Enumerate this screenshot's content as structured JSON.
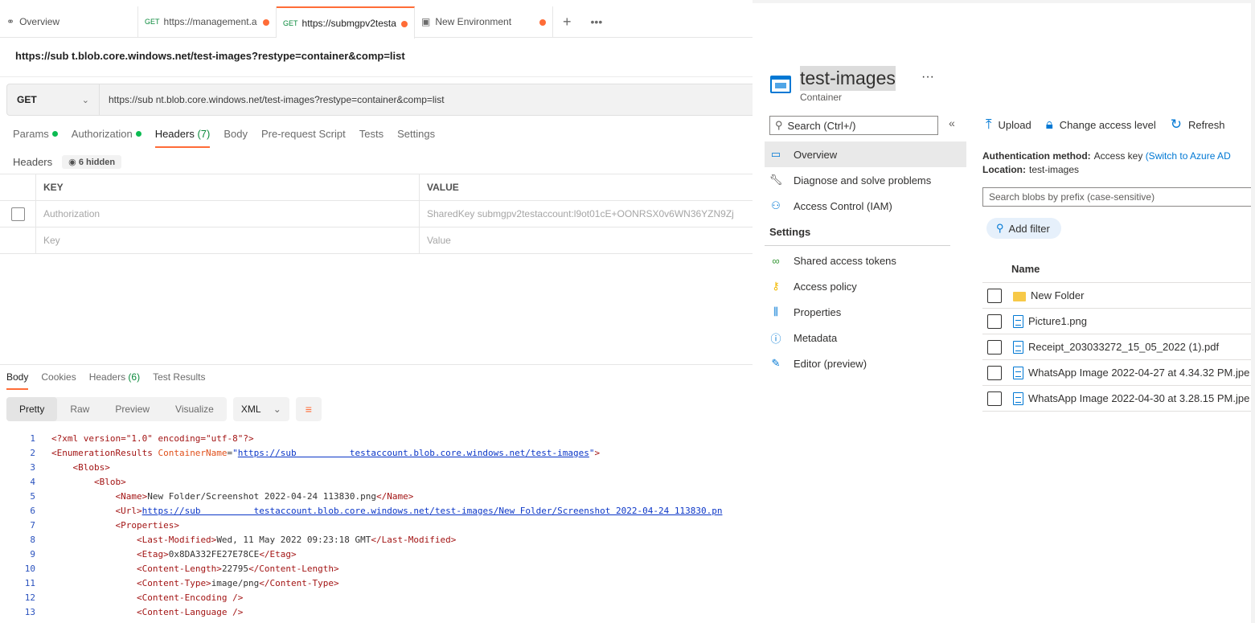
{
  "postman": {
    "tabs": [
      {
        "label": "Overview",
        "method": ""
      },
      {
        "label": "https://management.a",
        "method": "GET"
      },
      {
        "label": "https://submgpv2testa",
        "method": "GET"
      },
      {
        "label": "New Environment",
        "method": ""
      }
    ],
    "title": "https://sub      t.blob.core.windows.net/test-images?restype=container&comp=list",
    "method": "GET",
    "url": "https://sub              nt.blob.core.windows.net/test-images?restype=container&comp=list",
    "request_tabs": {
      "params": "Params",
      "authorization": "Authorization",
      "headers": "Headers",
      "headers_count": "(7)",
      "body": "Body",
      "prerequest": "Pre-request Script",
      "tests": "Tests",
      "settings": "Settings"
    },
    "headers_label": "Headers",
    "hidden_label": "6 hidden",
    "table": {
      "key_header": "KEY",
      "value_header": "VALUE",
      "rows": [
        {
          "key": "Authorization",
          "value": "SharedKey submgpv2testaccount:l9ot01cE+OONRSX0v6WN36YZN9Zj"
        },
        {
          "key": "Key",
          "value": "Value"
        }
      ]
    },
    "response_tabs": {
      "body": "Body",
      "cookies": "Cookies",
      "headers": "Headers",
      "headers_count": "(6)",
      "test_results": "Test Results"
    },
    "view_modes": [
      "Pretty",
      "Raw",
      "Preview",
      "Visualize"
    ],
    "format": "XML",
    "code": {
      "l1_decl": "<?xml version=\"1.0\" encoding=\"utf-8\"?>",
      "l2_url": "https://sub          testaccount.blob.core.windows.net/test-images",
      "l5_name": "New Folder/Screenshot 2022-04-24 113830.png",
      "l6_url": "https://sub          testaccount.blob.core.windows.net/test-images/New Folder/Screenshot 2022-04-24 113830.pn",
      "l8_modified": "Wed, 11 May 2022 09:23:18 GMT",
      "l9_etag": "0x8DA332FE27E78CE",
      "l10_length": "22795",
      "l11_type": "image/png"
    }
  },
  "azure": {
    "title": "test-images",
    "subtitle": "Container",
    "more": "···",
    "search_placeholder": "Search (Ctrl+/)",
    "collapse": "«",
    "nav": {
      "overview": "Overview",
      "diagnose": "Diagnose and solve problems",
      "iam": "Access Control (IAM)",
      "settings_header": "Settings",
      "sas": "Shared access tokens",
      "policy": "Access policy",
      "properties": "Properties",
      "metadata": "Metadata",
      "editor": "Editor (preview)"
    },
    "toolbar": {
      "upload": "Upload",
      "change_access": "Change access level",
      "refresh": "Refresh"
    },
    "auth_method_label": "Authentication method:",
    "auth_method_value": "Access key",
    "auth_switch": "(Switch to Azure AD",
    "location_label": "Location:",
    "location_value": "test-images",
    "blob_search_placeholder": "Search blobs by prefix (case-sensitive)",
    "add_filter": "Add filter",
    "name_header": "Name",
    "blobs": [
      {
        "name": "New Folder",
        "kind": "folder"
      },
      {
        "name": "Picture1.png",
        "kind": "file"
      },
      {
        "name": "Receipt_203033272_15_05_2022 (1).pdf",
        "kind": "file"
      },
      {
        "name": "WhatsApp Image 2022-04-27 at 4.34.32 PM.jpe",
        "kind": "file"
      },
      {
        "name": "WhatsApp Image 2022-04-30 at 3.28.15 PM.jpe",
        "kind": "file"
      }
    ]
  }
}
